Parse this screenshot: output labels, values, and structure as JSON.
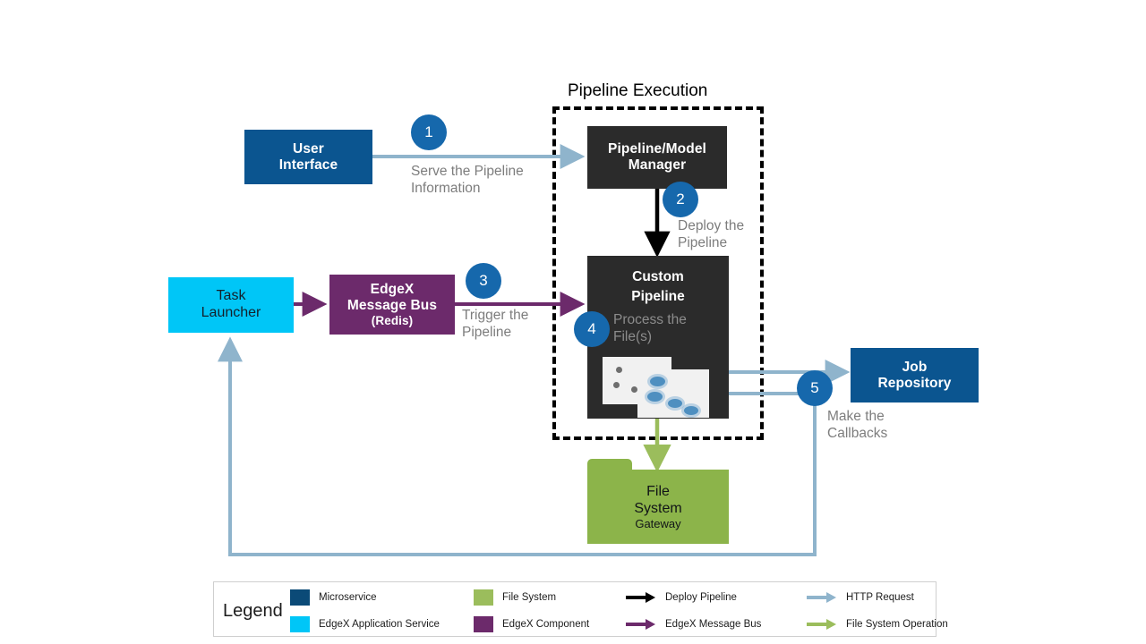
{
  "diagram": {
    "group": {
      "title": "Pipeline Execution"
    },
    "nodes": {
      "user_interface": {
        "title": "User\nInterface",
        "type": "microservice"
      },
      "task_launcher": {
        "title": "Task\nLauncher",
        "type": "edgex-application-service"
      },
      "edgex_message_bus": {
        "title": "EdgeX\nMessage Bus",
        "subtitle": "(Redis)",
        "type": "edgex-component"
      },
      "pipeline_model_manager": {
        "title": "Pipeline/Model\nManager",
        "type": "pipeline"
      },
      "custom_pipeline": {
        "title": "Custom\nPipeline",
        "type": "pipeline"
      },
      "job_repository": {
        "title": "Job\nRepository",
        "type": "microservice"
      },
      "file_system": {
        "title": "File\nSystem",
        "subtitle": "Gateway",
        "type": "file-system"
      }
    },
    "steps": [
      {
        "number": "1",
        "label": "Serve the Pipeline\nInformation"
      },
      {
        "number": "2",
        "label": "Deploy the\nPipeline"
      },
      {
        "number": "3",
        "label": "Trigger the\nPipeline"
      },
      {
        "number": "4",
        "label": "Process the\nFile(s)"
      },
      {
        "number": "5",
        "label": "Make the\nCallbacks"
      }
    ]
  },
  "legend": {
    "title": "Legend",
    "items": [
      {
        "kind": "swatch",
        "label": "Microservice",
        "color": "#0B4A77"
      },
      {
        "kind": "swatch",
        "label": "EdgeX Application Service",
        "color": "#00C6F7"
      },
      {
        "kind": "swatch",
        "label": "File System",
        "color": "#9BBD5C"
      },
      {
        "kind": "swatch",
        "label": "EdgeX Component",
        "color": "#6C2A6B"
      },
      {
        "kind": "arrow",
        "label": "Deploy Pipeline",
        "color": "#000000"
      },
      {
        "kind": "arrow",
        "label": "EdgeX Message Bus",
        "color": "#6C2A6B"
      },
      {
        "kind": "arrow",
        "label": "HTTP Request",
        "color": "#8FB4CC"
      },
      {
        "kind": "arrow",
        "label": "File System Operation",
        "color": "#9BBD5C"
      }
    ]
  },
  "colors": {
    "microservice": "#0B5590",
    "edgex_application_service": "#00C6F7",
    "edgex_component": "#6C2A6B",
    "file_system": "#8CB44A",
    "pipeline_dark": "#2B2B2B",
    "step_circle": "#1668AC",
    "http_request_arrow": "#8FB4CC",
    "deploy_arrow": "#000000",
    "message_bus_arrow": "#6C2A6B",
    "file_system_arrow": "#9BBD5C",
    "edge_label_text": "#7d7d7d"
  }
}
